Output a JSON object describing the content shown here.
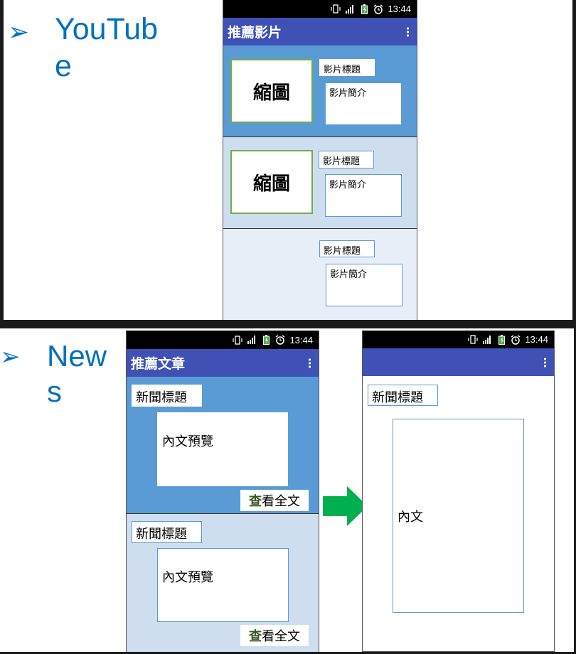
{
  "youtube_section": {
    "bullet": "➢",
    "heading_line1": "YouTub",
    "heading_line2": "e",
    "phone": {
      "time": "13:44",
      "app_title": "推薦影片",
      "cards": [
        {
          "thumbnail": "縮圖",
          "title": "影片標題",
          "summary": "影片簡介"
        },
        {
          "thumbnail": "縮圖",
          "title": "影片標題",
          "summary": "影片簡介"
        },
        {
          "thumbnail": "",
          "title": "影片標題",
          "summary": "影片簡介"
        }
      ]
    }
  },
  "news_section": {
    "bullet": "➢",
    "heading_line1": "New",
    "heading_line2": "s",
    "list_phone": {
      "time": "13:44",
      "app_title": "推薦文章",
      "cards": [
        {
          "title": "新聞標題",
          "preview": "內文預覽",
          "button_bold": "查",
          "button_rest": "看全文"
        },
        {
          "title": "新聞標題",
          "preview": "內文預覽",
          "button_bold": "查",
          "button_rest": "看全文"
        }
      ]
    },
    "detail_phone": {
      "time": "13:44",
      "app_title": "",
      "title": "新聞標題",
      "content": "內文"
    }
  },
  "colors": {
    "accent_blue": "#0070c0",
    "appbar": "#3f51b5",
    "card_dark": "#5b9bd5",
    "card_mid": "#cfdeee",
    "card_light": "#e8eef7",
    "arrow": "#00b050",
    "thumb_border": "#70ad47"
  },
  "icons": [
    "vibrate-icon",
    "signal-icon",
    "battery-icon",
    "alarm-icon",
    "overflow-menu-icon",
    "transition-arrow-icon"
  ]
}
